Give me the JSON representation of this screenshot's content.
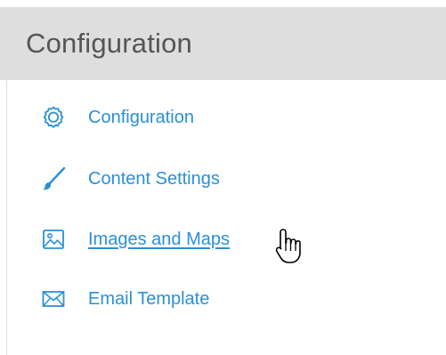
{
  "panel": {
    "title": "Configuration"
  },
  "menu": {
    "items": [
      {
        "id": "configuration",
        "label": "Configuration",
        "icon": "gear-icon"
      },
      {
        "id": "content-settings",
        "label": "Content Settings",
        "icon": "paintbrush-icon"
      },
      {
        "id": "images-and-maps",
        "label": "Images and Maps",
        "icon": "image-icon",
        "hovered": true
      },
      {
        "id": "email-template",
        "label": "Email Template",
        "icon": "envelope-icon"
      }
    ]
  },
  "colors": {
    "header_bg": "#dedede",
    "title_text": "#555555",
    "link": "#2b8fd6"
  },
  "cursor": {
    "icon": "hand-pointer-icon"
  }
}
